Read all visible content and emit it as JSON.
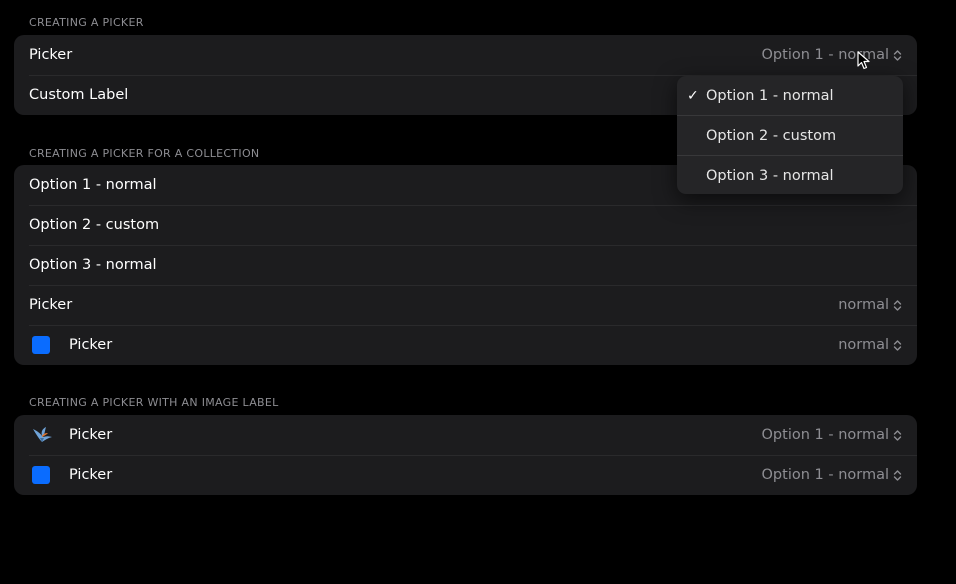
{
  "sections": [
    {
      "header": "CREATING A PICKER",
      "rows": [
        {
          "label": "Picker",
          "value": "Option 1 - normal"
        },
        {
          "label": "Custom Label"
        }
      ]
    },
    {
      "header": "CREATING A PICKER FOR A COLLECTION",
      "rows": [
        {
          "label": "Option 1 - normal"
        },
        {
          "label": "Option 2 - custom"
        },
        {
          "label": "Option 3 - normal"
        },
        {
          "label": "Picker",
          "value": "normal"
        },
        {
          "label": "Picker",
          "value": "normal",
          "icon": "blue-square-icon"
        }
      ]
    },
    {
      "header": "CREATING A PICKER WITH AN IMAGE LABEL",
      "rows": [
        {
          "label": "Picker",
          "value": "Option 1 - normal",
          "icon": "bird-app-icon"
        },
        {
          "label": "Picker",
          "value": "Option 1 - normal",
          "icon": "blue-square-icon"
        }
      ]
    }
  ],
  "menu": {
    "items": [
      {
        "label": "Option 1 - normal",
        "selected": true
      },
      {
        "label": "Option 2 - custom",
        "selected": false
      },
      {
        "label": "Option 3 - normal",
        "selected": false
      }
    ],
    "check_glyph": "✓"
  },
  "colors": {
    "background": "#000000",
    "group": "#1c1c1e",
    "secondary_text": "#8e8e93",
    "accent_blue": "#0a6cff"
  }
}
